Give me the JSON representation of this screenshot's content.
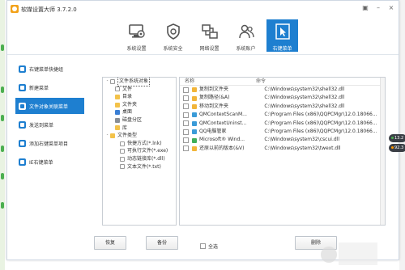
{
  "window": {
    "title": "软媒设置大师 3.7.2.0"
  },
  "toolbar": [
    {
      "label": "系统设置",
      "icon": "monitor-gear-icon",
      "active": false
    },
    {
      "label": "系统安全",
      "icon": "shield-icon",
      "active": false
    },
    {
      "label": "网络设置",
      "icon": "network-icon",
      "active": false
    },
    {
      "label": "系统账户",
      "icon": "users-icon",
      "active": false
    },
    {
      "label": "右键菜单",
      "icon": "cursor-icon",
      "active": true
    }
  ],
  "sidebar": [
    {
      "label": "右键菜单快捷组",
      "active": false
    },
    {
      "label": "新建菜单",
      "active": false
    },
    {
      "label": "文件对象关联菜单",
      "active": true
    },
    {
      "label": "发送到菜单",
      "active": false
    },
    {
      "label": "添加右键菜单项目",
      "active": false
    },
    {
      "label": "IE右键菜单",
      "active": false
    }
  ],
  "tree": [
    {
      "label": "文件系统对象",
      "toggle": "-",
      "indent": 0,
      "icon": "i-doc",
      "selected": true
    },
    {
      "label": "文件",
      "toggle": "",
      "indent": 1,
      "icon": "i-doc",
      "selected": false
    },
    {
      "label": "目录",
      "toggle": "",
      "indent": 1,
      "icon": "i-fold",
      "selected": false
    },
    {
      "label": "文件夹",
      "toggle": "",
      "indent": 1,
      "icon": "i-fold",
      "selected": false
    },
    {
      "label": "桌面",
      "toggle": "",
      "indent": 1,
      "icon": "i-blue",
      "selected": false
    },
    {
      "label": "磁盘分区",
      "toggle": "",
      "indent": 1,
      "icon": "i-gray",
      "selected": false
    },
    {
      "label": "库",
      "toggle": "",
      "indent": 1,
      "icon": "i-fold",
      "selected": false
    },
    {
      "label": "文件类型",
      "toggle": "-",
      "indent": 0,
      "icon": "i-fold",
      "selected": false
    },
    {
      "label": "快捷方式(*.lnk)",
      "toggle": "",
      "indent": 2,
      "icon": "i-doc",
      "selected": false
    },
    {
      "label": "可执行文件(*.exe)",
      "toggle": "",
      "indent": 2,
      "icon": "i-doc",
      "selected": false
    },
    {
      "label": "动态链接库(*.dll)",
      "toggle": "",
      "indent": 2,
      "icon": "i-doc",
      "selected": false
    },
    {
      "label": "文本文件(*.txt)",
      "toggle": "",
      "indent": 2,
      "icon": "i-doc",
      "selected": false
    }
  ],
  "list": {
    "columns": [
      "名称",
      "命令"
    ],
    "rows": [
      {
        "name": "复制到文件夹",
        "cmd": "C:\\Windows\\system32\\shell32.dll",
        "color": "#f2b53a"
      },
      {
        "name": "复制路径(&A)",
        "cmd": "C:\\Windows\\system32\\shell32.dll",
        "color": "#f2b53a"
      },
      {
        "name": "移动到文件夹",
        "cmd": "C:\\Windows\\system32\\shell32.dll",
        "color": "#f2b53a"
      },
      {
        "name": "QMContextScanM...",
        "cmd": "C:\\Program Files (x86)\\QQPCMgr\\12.0.18066...",
        "color": "#3a9bd8"
      },
      {
        "name": "QMContextUninst...",
        "cmd": "C:\\Program Files (x86)\\QQPCMgr\\12.0.18066...",
        "color": "#3a9bd8"
      },
      {
        "name": "QQ电脑管家",
        "cmd": "C:\\Program Files (x86)\\QQPCMgr\\12.0.18066...",
        "color": "#3a9bd8"
      },
      {
        "name": "Microsoft® Wind...",
        "cmd": "C:\\Windows\\system32\\cscui.dll",
        "color": "#3fae5a"
      },
      {
        "name": "还原以前的版本(&V)",
        "cmd": "C:\\Windows\\system32\\twext.dll",
        "color": "#f2b53a"
      }
    ]
  },
  "buttons": {
    "restore": "恢复",
    "backup": "备份",
    "select_all": "全选",
    "delete": "删除"
  },
  "floating": [
    {
      "text": "13.2",
      "dot": "#4caf50"
    },
    {
      "text": "92.3",
      "dot": "#ff9800"
    }
  ]
}
